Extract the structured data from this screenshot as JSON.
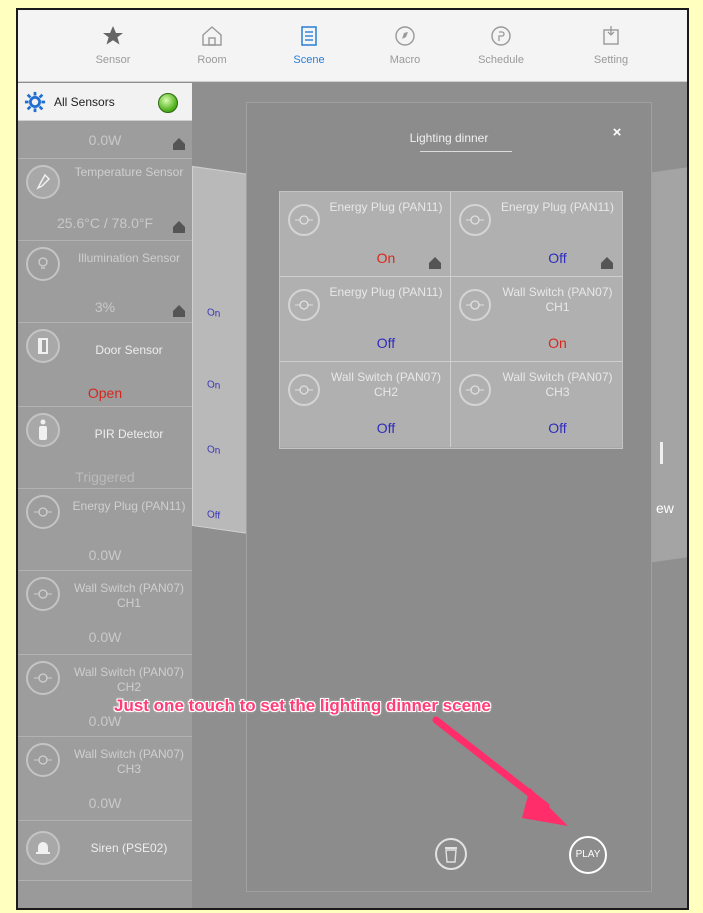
{
  "tabs": [
    {
      "label": "Sensor",
      "icon": "star-icon"
    },
    {
      "label": "Room",
      "icon": "house-icon"
    },
    {
      "label": "Scene",
      "icon": "list-icon"
    },
    {
      "label": "Macro",
      "icon": "compass-icon"
    },
    {
      "label": "Schedule",
      "icon": "clock-icon"
    },
    {
      "label": "Setting",
      "icon": "settings-icon"
    }
  ],
  "active_tab": "Scene",
  "accent_color": "#2a7fd6",
  "sidebar": {
    "title": "All Sensors",
    "items": [
      {
        "value": "0.0W"
      },
      {
        "name": "Temperature Sensor",
        "value": "25.6°C / 78.0°F"
      },
      {
        "name": "Illumination Sensor",
        "value": "3%"
      },
      {
        "name": "Door Sensor",
        "value": "Open"
      },
      {
        "name": "PIR Detector",
        "value": "Triggered"
      },
      {
        "name": "Energy Plug (PAN11)",
        "value": "0.0W"
      },
      {
        "name": "Wall Switch (PAN07) CH1",
        "value": "0.0W"
      },
      {
        "name": "Wall Switch (PAN07) CH2",
        "value": "0.0W"
      },
      {
        "name": "Wall Switch (PAN07) CH3",
        "value": "0.0W"
      },
      {
        "name": "Siren (PSE02)"
      }
    ]
  },
  "background_pane": {
    "states": [
      "On",
      "On",
      "On",
      "Off"
    ]
  },
  "background_right_text": "ew",
  "modal": {
    "title": "Lighting dinner",
    "devices": [
      {
        "name": "Energy Plug (PAN11)",
        "state": "On"
      },
      {
        "name": "Energy Plug (PAN11)",
        "state": "Off"
      },
      {
        "name": "Energy Plug (PAN11)",
        "state": "Off"
      },
      {
        "name": "Wall Switch (PAN07) CH1",
        "state": "On"
      },
      {
        "name": "Wall Switch (PAN07) CH2",
        "state": "Off"
      },
      {
        "name": "Wall Switch (PAN07) CH3",
        "state": "Off"
      }
    ],
    "play_label": "PLAY",
    "close_glyph": "×"
  },
  "annotation": "Just one touch to set the lighting dinner scene",
  "colors": {
    "on": "#d8281e",
    "off": "#2e2bbf",
    "annotation": "#ff3d77",
    "status_green": "#4fb01c"
  }
}
